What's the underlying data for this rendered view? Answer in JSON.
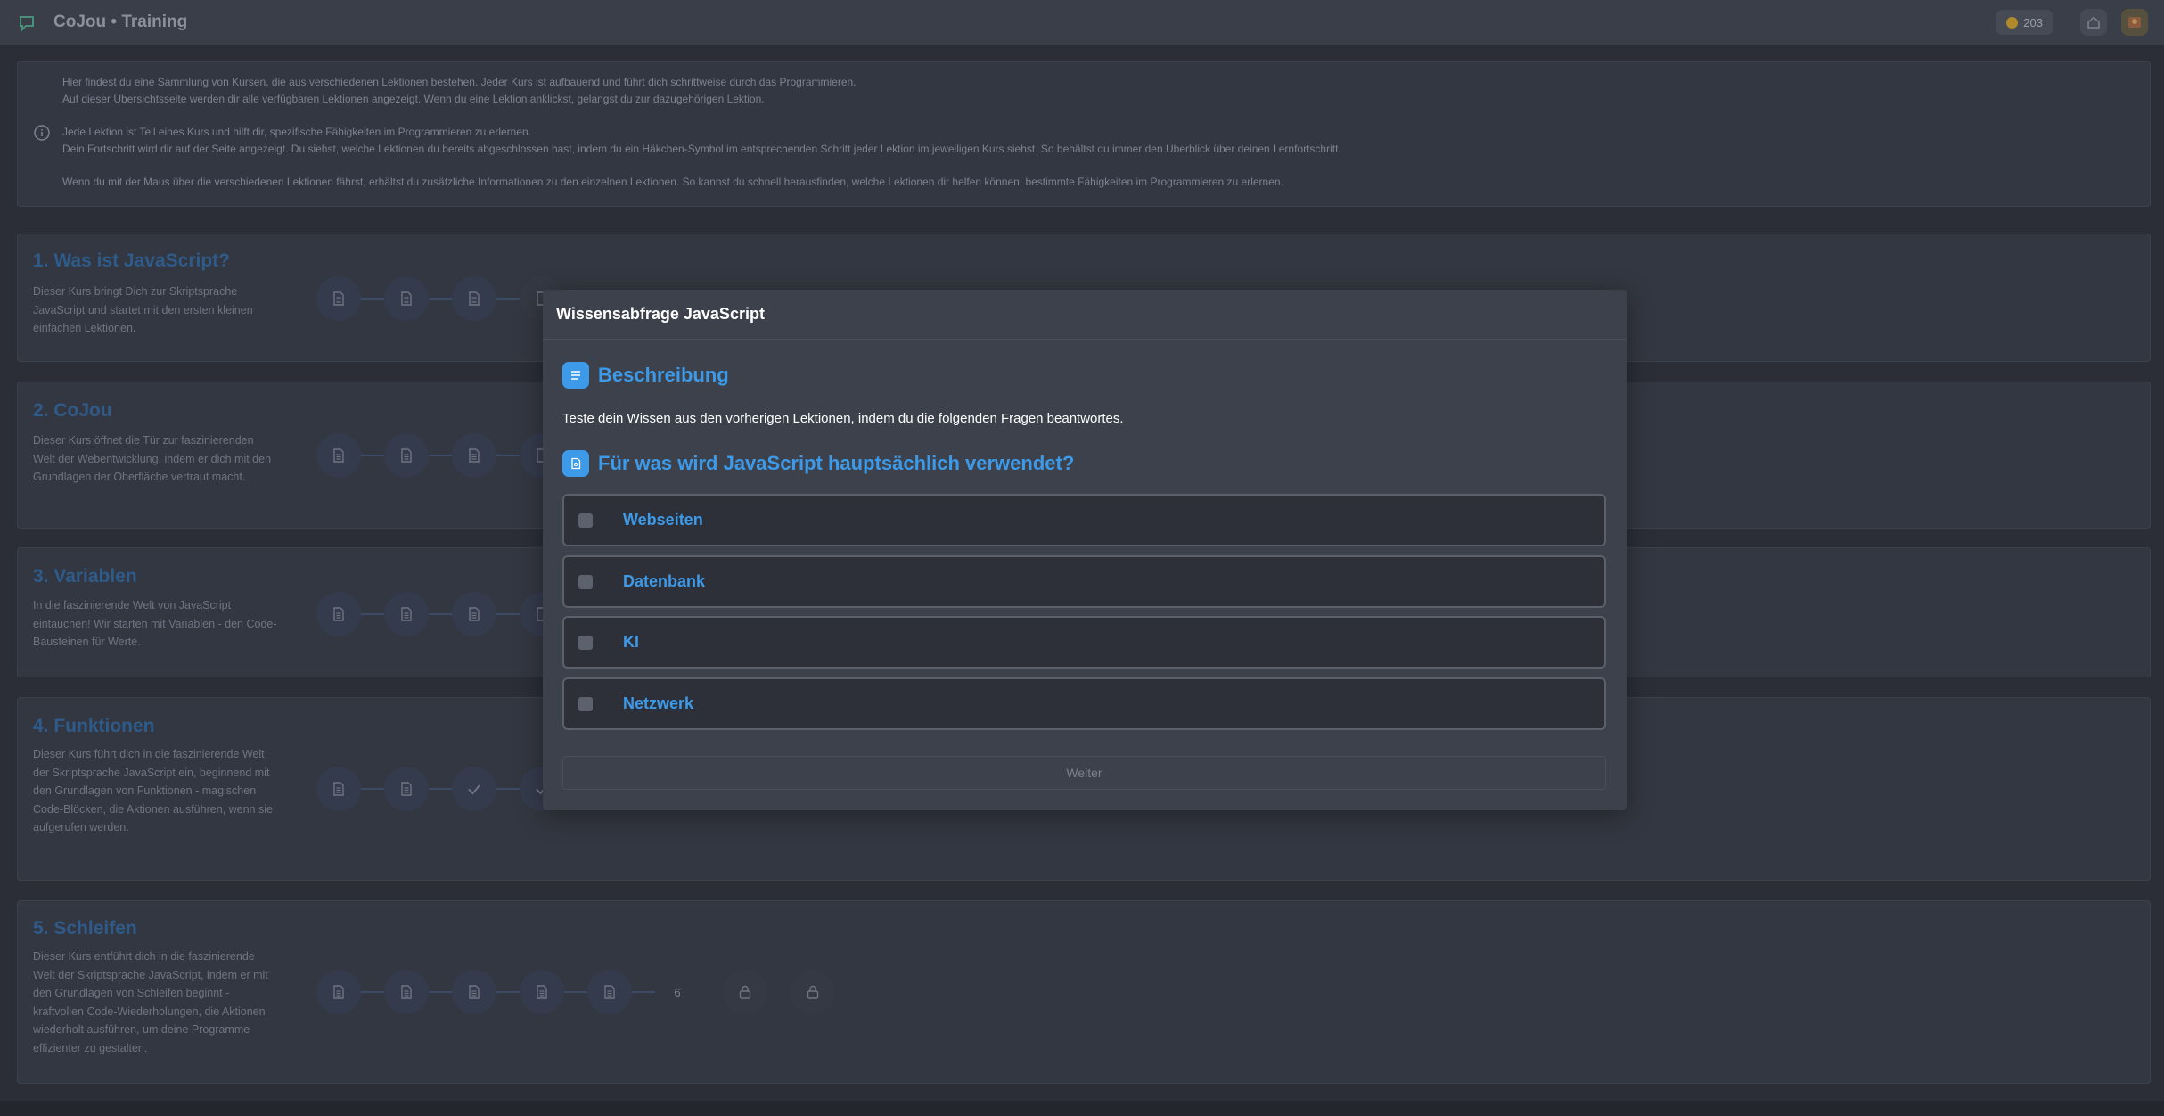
{
  "app": {
    "title": "CoJou • Training"
  },
  "topbar": {
    "coins": "203"
  },
  "info": {
    "paragraph1": [
      "Hier findest du eine Sammlung von Kursen, die aus verschiedenen Lektionen bestehen. Jeder Kurs ist aufbauend und führt dich schrittweise durch das Programmieren.",
      "Auf dieser Übersichtsseite werden dir alle verfügbaren Lektionen angezeigt. Wenn du eine Lektion anklickst, gelangst du zur dazugehörigen Lektion."
    ],
    "paragraph2": [
      "Jede Lektion ist Teil eines Kurs und hilft dir, spezifische Fähigkeiten im Programmieren zu erlernen.",
      "Dein Fortschritt wird dir auf der Seite angezeigt. Du siehst, welche Lektionen du bereits abgeschlossen hast, indem du ein Häkchen-Symbol im entsprechenden Schritt jeder Lektion im jeweiligen Kurs siehst. So behältst du immer den Überblick über deinen Lernfortschritt."
    ],
    "paragraph3": [
      "Wenn du mit der Maus über die verschiedenen Lektionen fährst, erhältst du zusätzliche Informationen zu den einzelnen Lektionen. So kannst du schnell herausfinden, welche Lektionen dir helfen können, bestimmte Fähigkeiten im Programmieren zu erlernen."
    ]
  },
  "courses": [
    {
      "title": "1. Was ist JavaScript?",
      "description": "Dieser Kurs bringt Dich zur Skriptsprache JavaScript und startet mit den ersten kleinen einfachen Lektionen.",
      "lessons": [
        "doc",
        "doc",
        "doc",
        "doc"
      ]
    },
    {
      "title": "2. CoJou",
      "description": "Dieser Kurs öffnet die Tür zur faszinierenden Welt der Webentwicklung, indem er dich mit den Grundlagen der Oberfläche vertraut macht.",
      "lessons": [
        "doc",
        "doc",
        "doc",
        "doc"
      ]
    },
    {
      "title": "3. Variablen",
      "description": "In die faszinierende Welt von JavaScript eintauchen! Wir starten mit Variablen - den Code-Bausteinen für Werte.",
      "lessons": [
        "doc",
        "doc",
        "doc",
        "doc"
      ]
    },
    {
      "title": "4. Funktionen",
      "description": "Dieser Kurs führt dich in die faszinierende Welt der Skriptsprache JavaScript ein, beginnend mit den Grundlagen von Funktionen - magischen Code-Blöcken, die Aktionen ausführen, wenn sie aufgerufen werden.",
      "lessons": [
        "doc",
        "doc",
        "check",
        "check"
      ]
    },
    {
      "title": "5. Schleifen",
      "description": "Dieser Kurs entführt dich in die faszinierende Welt der Skriptsprache JavaScript, indem er mit den Grundlagen von Schleifen beginnt - kraftvollen Code-Wiederholungen, die Aktionen wiederholt ausführen, um deine Programme effizienter zu gestalten.",
      "lessons": [
        "doc",
        "doc",
        "doc",
        "doc",
        "doc",
        "6",
        "lock",
        "lock"
      ]
    }
  ],
  "modal": {
    "title": "Wissensabfrage JavaScript",
    "description_heading": "Beschreibung",
    "description_text": "Teste dein Wissen aus den vorherigen Lektionen, indem du die folgenden Fragen beantwortes.",
    "question": "Für was wird JavaScript hauptsächlich verwendet?",
    "options": [
      "Webseiten",
      "Datenbank",
      "KI",
      "Netzwerk"
    ],
    "next_label": "Weiter"
  },
  "colors": {
    "accent": "#3d9ae8",
    "background": "#2b2e37"
  }
}
